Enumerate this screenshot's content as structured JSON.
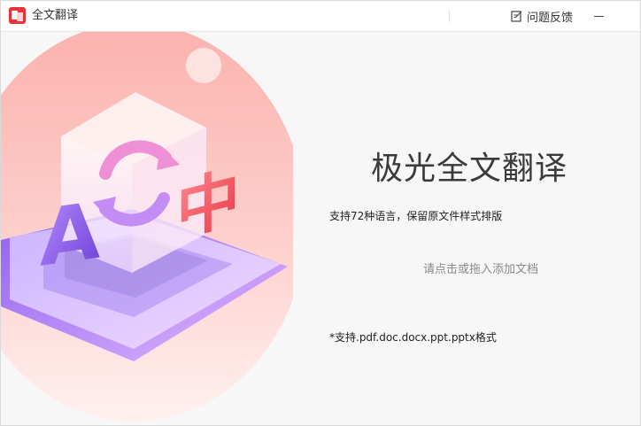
{
  "window": {
    "title": "全文翻译",
    "feedback_label": "问题反馈"
  },
  "main": {
    "app_name": "极光全文翻译",
    "subtitle": "支持72种语言，保留原文件样式排版",
    "drop_hint": "请点击或拖入添加文档",
    "formats_note": "*支持.pdf.doc.docx.ppt.pptx格式"
  },
  "illustration": {
    "letter_a": "A",
    "letter_zh": "中"
  },
  "icons": {
    "app": "app-logo-icon",
    "feedback": "feedback-edit-icon",
    "minimize": "minimize-icon"
  },
  "colors": {
    "accent_red": "#e8333c",
    "hero_pink": "#f9a4a1",
    "hero_purple": "#9b6cf0"
  }
}
